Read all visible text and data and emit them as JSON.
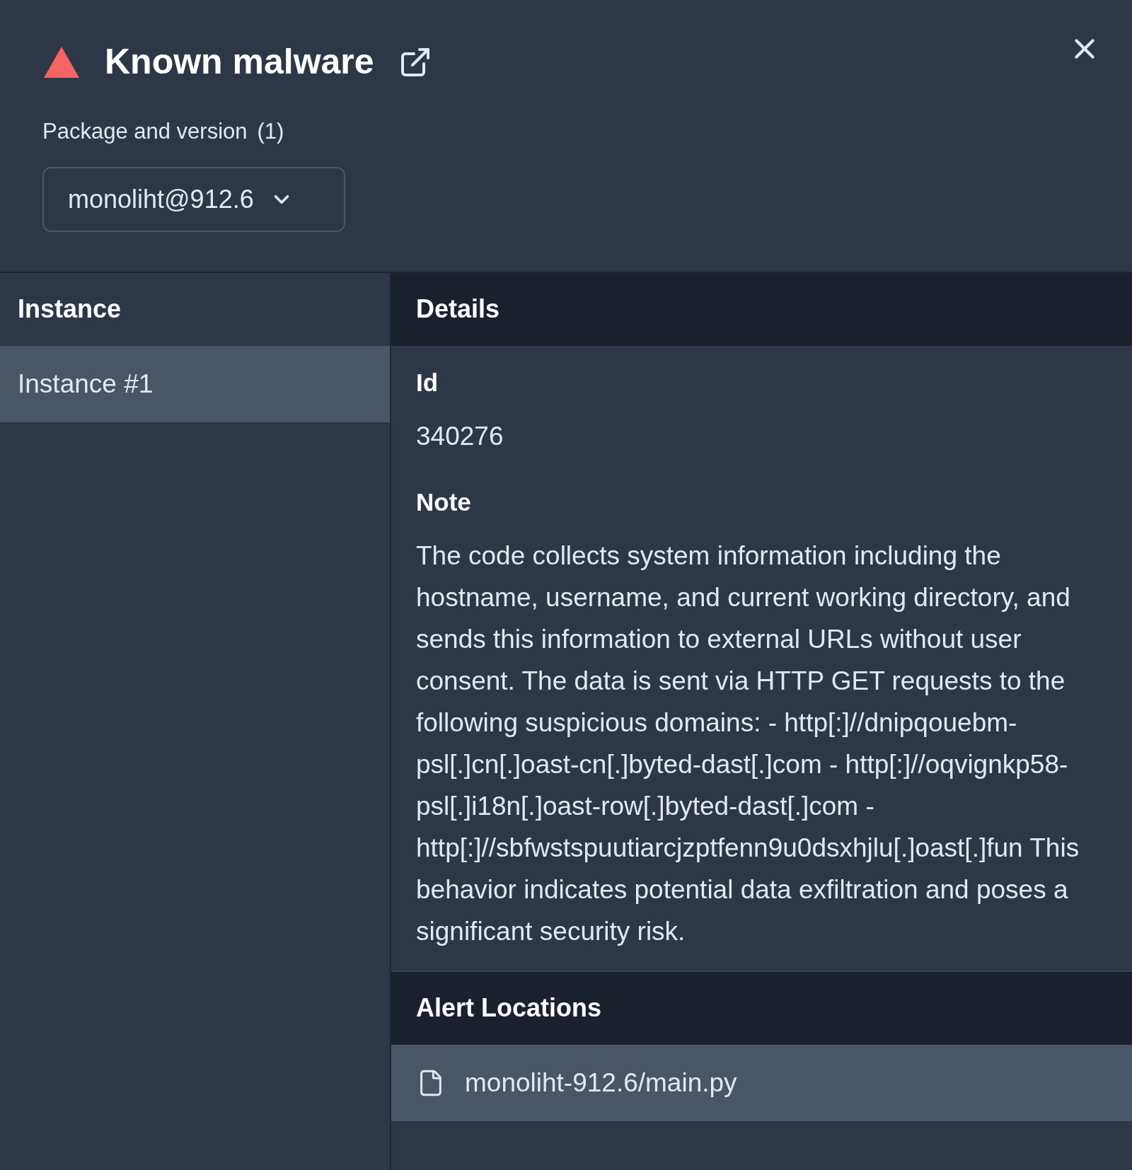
{
  "header": {
    "title": "Known malware"
  },
  "package": {
    "label": "Package and version",
    "count": "(1)",
    "value": "monoliht@912.6"
  },
  "instances": {
    "heading": "Instance",
    "items": [
      {
        "label": "Instance #1",
        "selected": true
      }
    ]
  },
  "details": {
    "heading": "Details",
    "fields": [
      {
        "label": "Id",
        "value": "340276"
      },
      {
        "label": "Note",
        "value": "The code collects system information including the hostname, username, and current working directory, and sends this information to external URLs without user consent. The data is sent via HTTP GET requests to the following suspicious domains: - http[:]//dnipqouebm-psl[.]cn[.]oast-cn[.]byted-dast[.]com - http[:]//oqvignkp58-psl[.]i18n[.]oast-row[.]byted-dast[.]com - http[:]//sbfwstspuutiarcjzptfenn9u0dsxhjlu[.]oast[.]fun This behavior indicates potential data exfiltration and poses a significant security risk."
      }
    ]
  },
  "alert_locations": {
    "heading": "Alert Locations",
    "items": [
      {
        "path": "monoliht-912.6/main.py"
      }
    ]
  }
}
